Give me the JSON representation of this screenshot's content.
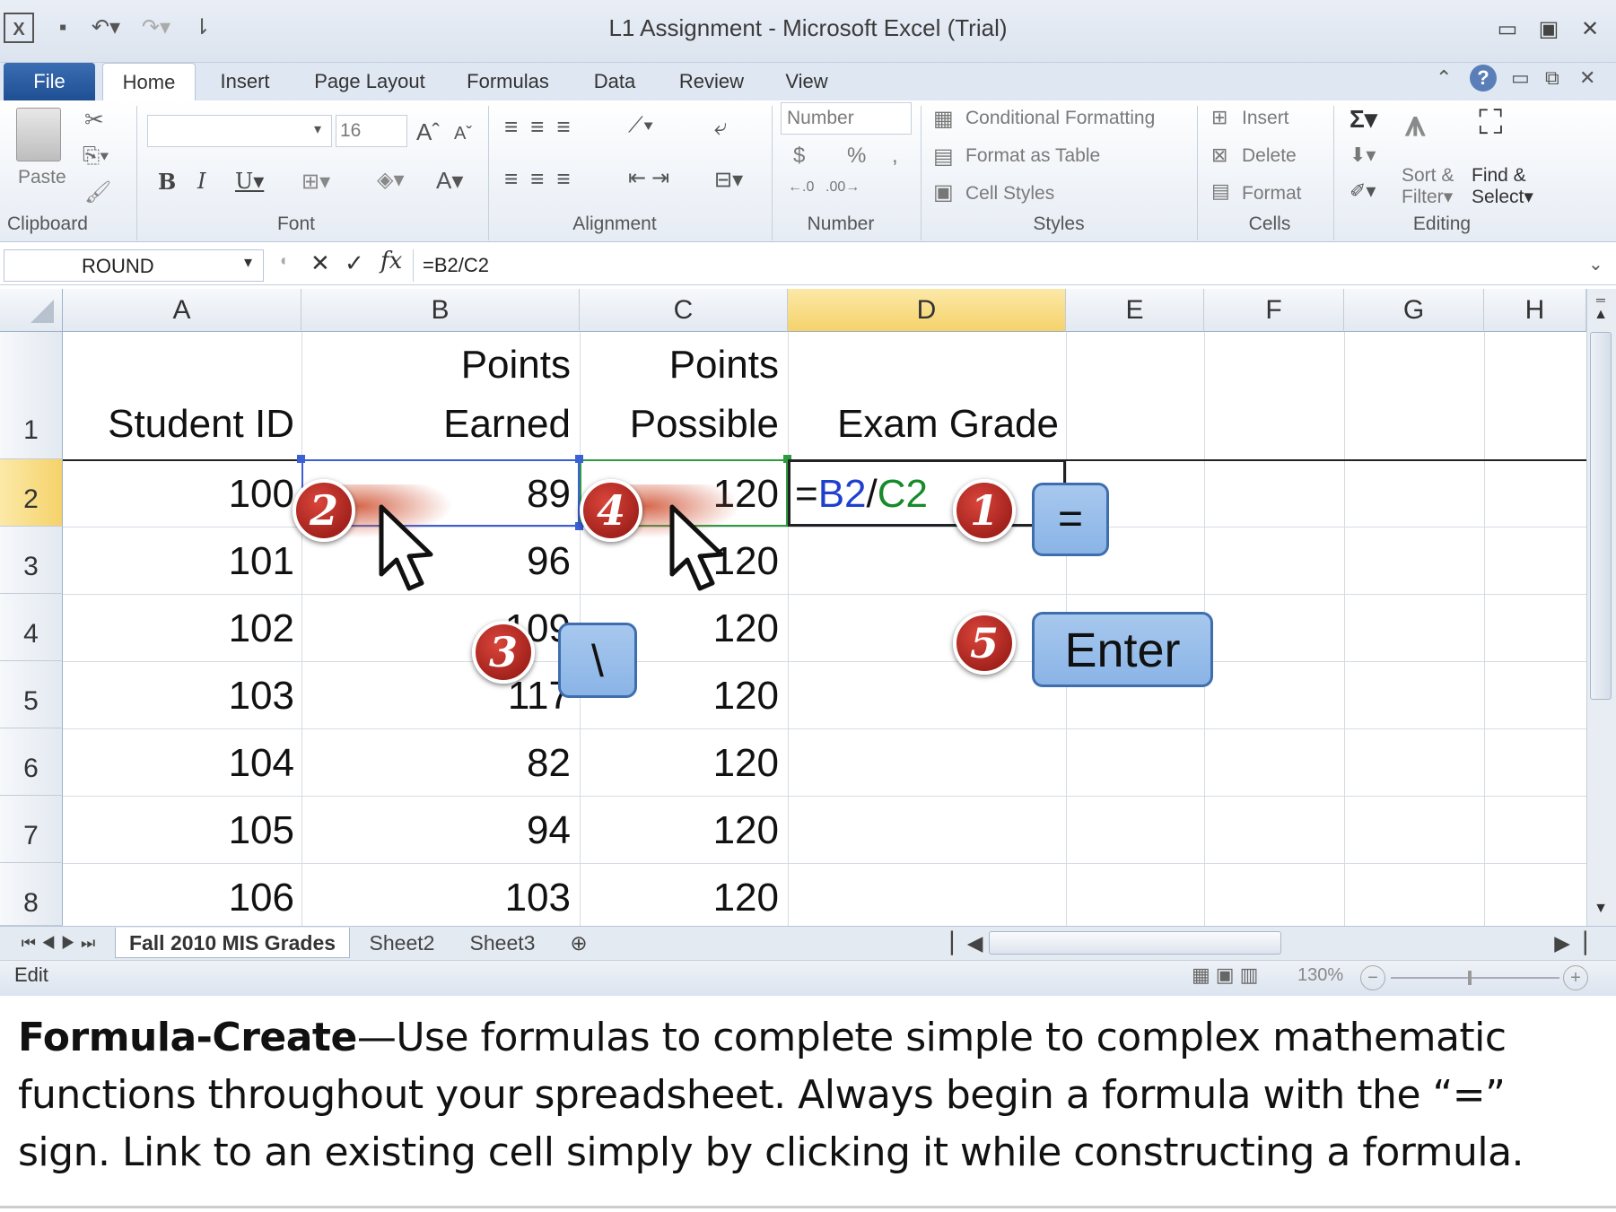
{
  "window": {
    "title": "L1 Assignment  -  Microsoft Excel (Trial)",
    "controls": [
      "▭",
      "▣",
      "✕"
    ]
  },
  "ribbon": {
    "tabs": [
      "File",
      "Home",
      "Insert",
      "Page Layout",
      "Formulas",
      "Data",
      "Review",
      "View"
    ],
    "groups": {
      "clipboard": {
        "label": "Clipboard",
        "paste": "Paste"
      },
      "font": {
        "label": "Font",
        "size": "16"
      },
      "alignment": {
        "label": "Alignment"
      },
      "number": {
        "label": "Number",
        "format": "Number",
        "currency": "$",
        "percent": "%",
        "comma": ","
      },
      "styles": {
        "label": "Styles",
        "conditional": "Conditional Formatting",
        "format_table": "Format as Table",
        "cell_styles": "Cell Styles"
      },
      "cells": {
        "label": "Cells",
        "insert": "Insert",
        "delete": "Delete",
        "format": "Format"
      },
      "editing": {
        "label": "Editing",
        "sort1": "Sort &",
        "sort2": "Filter",
        "find1": "Find &",
        "find2": "Select"
      }
    }
  },
  "formula_bar": {
    "name_box": "ROUND",
    "formula": "=B2/C2"
  },
  "grid": {
    "columns": [
      "A",
      "B",
      "C",
      "D",
      "E",
      "F",
      "G",
      "H"
    ],
    "selected_column": "D",
    "rows": [
      "1",
      "2",
      "3",
      "4",
      "5",
      "6",
      "7",
      "8"
    ],
    "selected_row": "2",
    "headers": {
      "a": "Student ID",
      "b1": "Points",
      "b2": "Earned",
      "c1": "Points",
      "c2": "Possible",
      "d": "Exam Grade"
    },
    "data": [
      {
        "id": "100",
        "earned": "89",
        "possible": "120"
      },
      {
        "id": "101",
        "earned": "96",
        "possible": "120"
      },
      {
        "id": "102",
        "earned": "109",
        "possible": "120"
      },
      {
        "id": "103",
        "earned": "117",
        "possible": "120"
      },
      {
        "id": "104",
        "earned": "82",
        "possible": "120"
      },
      {
        "id": "105",
        "earned": "94",
        "possible": "120"
      },
      {
        "id": "106",
        "earned": "103",
        "possible": "120"
      }
    ],
    "editing_cell": {
      "eq": "=",
      "ref1": "B2",
      "slash": "/",
      "ref2": "C2"
    }
  },
  "sheets": {
    "tabs": [
      "Fall 2010 MIS Grades",
      "Sheet2",
      "Sheet3"
    ]
  },
  "status": {
    "mode": "Edit",
    "zoom": "130%"
  },
  "callouts": {
    "step1": "1",
    "key1": "=",
    "step2": "2",
    "step3": "3",
    "key3": "\\",
    "step4": "4",
    "step5": "5",
    "key5": "Enter"
  },
  "caption": {
    "bold": "Formula-Create",
    "text": "—Use formulas to complete simple to complex mathematic functions throughout your spreadsheet.  Always begin a formula with the “=” sign.  Link to an existing cell simply by clicking it while constructing a formula."
  },
  "colors": {
    "ref_blue": "#1f3fcf",
    "ref_green": "#178a2a",
    "selected_header": "#f5d26a",
    "callout_red": "#b8221b",
    "key_blue": "#8ab4e6"
  }
}
